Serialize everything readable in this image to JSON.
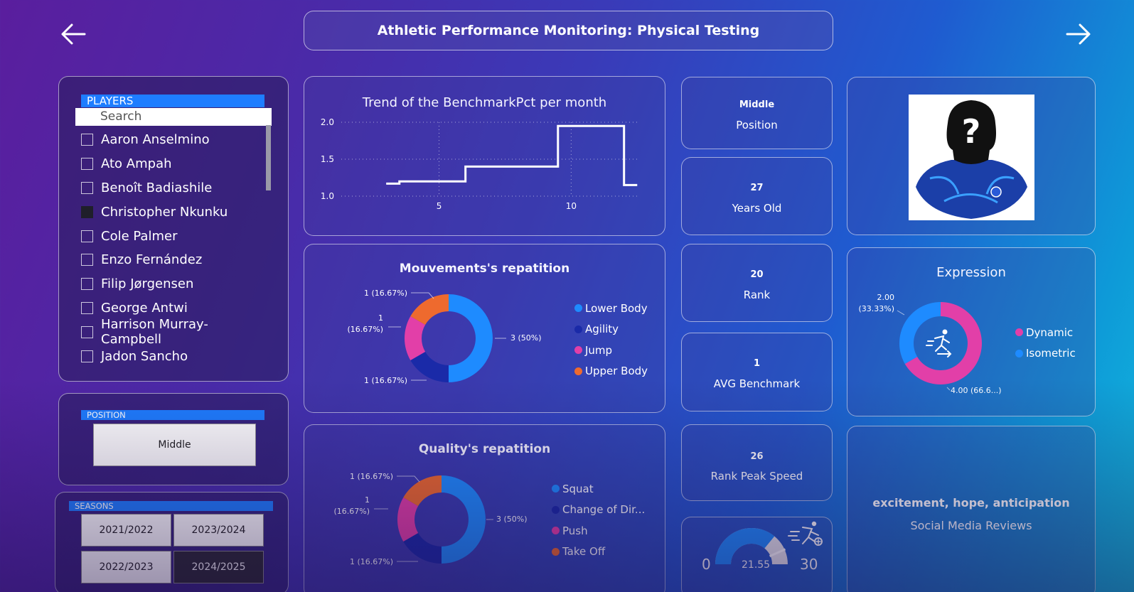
{
  "header": {
    "title": "Athletic Performance Monitoring: Physical Testing"
  },
  "players": {
    "header": "PLAYERS",
    "search_placeholder": "Search",
    "items": [
      {
        "name": "Aaron Anselmino",
        "checked": false
      },
      {
        "name": "Ato Ampah",
        "checked": false
      },
      {
        "name": "Benoît Badiashile",
        "checked": false
      },
      {
        "name": "Christopher Nkunku",
        "checked": true
      },
      {
        "name": "Cole Palmer",
        "checked": false
      },
      {
        "name": "Enzo Fernández",
        "checked": false
      },
      {
        "name": "Filip Jørgensen",
        "checked": false
      },
      {
        "name": "George Antwi",
        "checked": false
      },
      {
        "name": "Harrison Murray-Campbell",
        "checked": false
      },
      {
        "name": "Jadon Sancho",
        "checked": false
      }
    ]
  },
  "position_filter": {
    "header": "POSITION",
    "value": "Middle"
  },
  "seasons": {
    "header": "SEASONS",
    "items": [
      {
        "label": "2021/2022",
        "selected": false
      },
      {
        "label": "2023/2024",
        "selected": false
      },
      {
        "label": "2022/2023",
        "selected": false
      },
      {
        "label": "2024/2025",
        "selected": true
      }
    ]
  },
  "kpis": {
    "position": {
      "value": "Middle",
      "label": "Position"
    },
    "age": {
      "value": "27",
      "label": "Years Old"
    },
    "rank": {
      "value": "20",
      "label": "Rank"
    },
    "avg_benchmark": {
      "value": "1",
      "label": "AVG Benchmark"
    },
    "rank_peak_speed": {
      "value": "26",
      "label": "Rank Peak Speed"
    }
  },
  "gauge": {
    "min_label": "0",
    "max_label": "30",
    "value_label": "21.55",
    "min": 0,
    "max": 30,
    "value": 21.55,
    "target": 26,
    "fill_color": "#1e8bff",
    "rest_color": "#e8e8ee",
    "icon": "sprinter-icon"
  },
  "social": {
    "sentiment": "excitement, hope, anticipation",
    "label": "Social Media Reviews"
  },
  "player_photo": {
    "icon": "unknown-player-silhouette-icon"
  },
  "colors": {
    "blue": "#1e8bff",
    "navy": "#1a2aa8",
    "pink": "#e23fa8",
    "orange": "#ee6a2e"
  },
  "chart_data": [
    {
      "type": "line",
      "title": "Trend of the BenchmarkPct per month",
      "x_ticks": [
        "5",
        "10"
      ],
      "y_ticks": [
        "1.0",
        "1.5",
        "2.0"
      ],
      "xlim": [
        1.3,
        12.6
      ],
      "ylim": [
        1.0,
        2.0
      ],
      "step": true,
      "series": [
        {
          "x": [
            3,
            3.5,
            6,
            9.5,
            12,
            12.5
          ],
          "y": [
            1.17,
            1.2,
            1.4,
            1.95,
            1.15,
            1.15
          ]
        }
      ],
      "grid": true
    },
    {
      "type": "pie",
      "donut": true,
      "title": "Mouvements's repatition",
      "categories": [
        "Lower Body",
        "Agility",
        "Jump",
        "Upper Body"
      ],
      "values": [
        3,
        1,
        1,
        1
      ],
      "labels": [
        "3 (50%)",
        "1 (16.67%)",
        "1\n(16.67%)",
        "1 (16.67%)"
      ],
      "legend": "right"
    },
    {
      "type": "pie",
      "donut": true,
      "title": "Quality's repatition",
      "categories": [
        "Squat",
        "Change of Dir...",
        "Push",
        "Take Off"
      ],
      "values": [
        3,
        1,
        1,
        1
      ],
      "labels": [
        "3 (50%)",
        "1 (16.67%)",
        "1\n(16.67%)",
        "1 (16.67%)"
      ],
      "legend": "right"
    },
    {
      "type": "pie",
      "donut": true,
      "title": "Expression",
      "categories": [
        "Dynamic",
        "Isometric"
      ],
      "values": [
        4,
        2
      ],
      "labels": [
        "4.00 (66.6...)",
        "2.00\n(33.33%)"
      ],
      "legend": "right"
    }
  ]
}
